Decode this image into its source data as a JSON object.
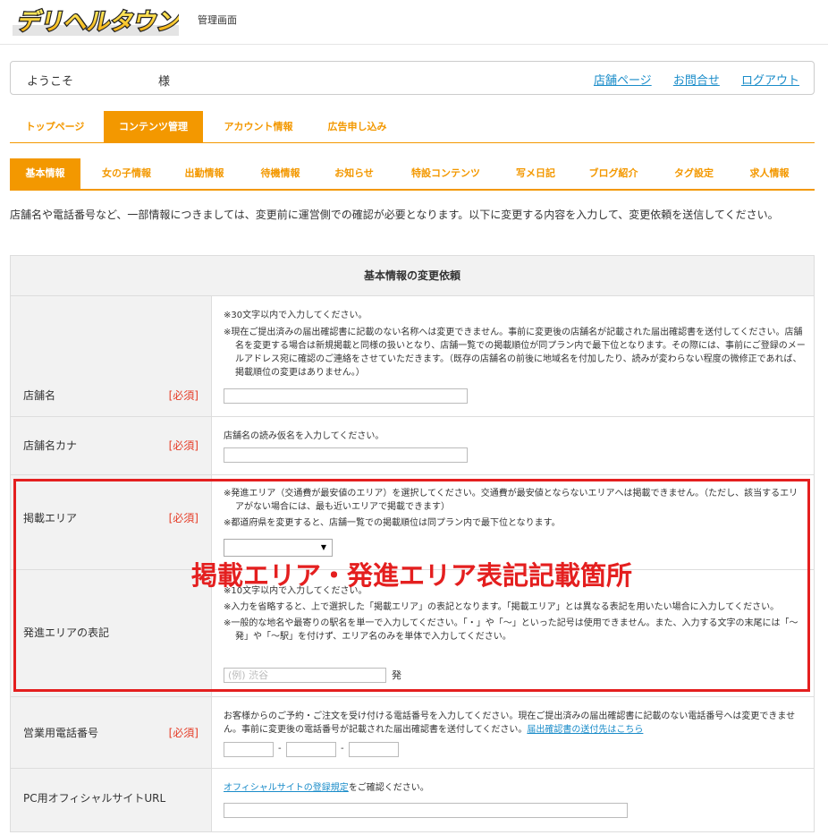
{
  "header": {
    "logo_text": "デリヘルタウン",
    "admin_label": "管理画面"
  },
  "welcome": {
    "greeting": "ようこそ",
    "suffix": "様",
    "links": [
      "店舗ページ",
      "お問合せ",
      "ログアウト"
    ]
  },
  "tabs_main": [
    "トップページ",
    "コンテンツ管理",
    "アカウント情報",
    "広告申し込み"
  ],
  "tabs_main_active": "コンテンツ管理",
  "tabs_sub": [
    "基本情報",
    "女の子情報",
    "出勤情報",
    "待機情報",
    "お知らせ",
    "特設コンテンツ",
    "写メ日記",
    "ブログ紹介",
    "タグ設定",
    "求人情報"
  ],
  "tabs_sub_active": "基本情報",
  "notice": "店舗名や電話番号など、一部情報につきましては、変更前に運営側での確認が必要となります。以下に変更する内容を入力して、変更依頼を送信してください。",
  "form": {
    "title": "基本情報の変更依頼",
    "required_label": "[必須]",
    "store_name": {
      "label": "店舗名",
      "note1": "※30文字以内で入力してください。",
      "note2": "※現在ご提出済みの届出確認書に記載のない名称へは変更できません。事前に変更後の店舗名が記載された届出確認書を送付してください。店舗名を変更する場合は新規掲載と同様の扱いとなり、店舗一覧での掲載順位が同プラン内で最下位となります。その際には、事前にご登録のメールアドレス宛に確認のご連絡をさせていただきます。（既存の店舗名の前後に地域名を付加したり、読みが変わらない程度の微修正であれば、掲載順位の変更はありません。）",
      "value": ""
    },
    "store_kana": {
      "label": "店舗名カナ",
      "note": "店舗名の読み仮名を入力してください。",
      "value": ""
    },
    "area": {
      "label": "掲載エリア",
      "note1": "※発進エリア（交通費が最安値のエリア）を選択してください。交通費が最安値とならないエリアへは掲載できません。（ただし、該当するエリアがない場合には、最も近いエリアで掲載できます）",
      "note2": "※都道府県を変更すると、店舗一覧での掲載順位は同プラン内で最下位となります。",
      "selected": ""
    },
    "departure": {
      "label": "発進エリアの表記",
      "note1": "※10文字以内で入力してください。",
      "note2": "※入力を省略すると、上で選択した「掲載エリア」の表記となります。「掲載エリア」とは異なる表記を用いたい場合に入力してください。",
      "note3": "※一般的な地名や最寄りの駅名を単一で入力してください。「・」や「〜」といった記号は使用できません。また、入力する文字の末尾には「〜発」や「〜駅」を付けず、エリア名のみを単体で入力してください。",
      "placeholder": "(例) 渋谷",
      "suffix": "発"
    },
    "phone": {
      "label": "営業用電話番号",
      "note_text": "お客様からのご予約・ご注文を受け付ける電話番号を入力してください。現在ご提出済みの届出確認書に記載のない電話番号へは変更できません。事前に変更後の電話番号が記載された届出確認書を送付してください。",
      "note_link": "届出確認書の送付先はこちら",
      "sep": "-"
    },
    "pc_url": {
      "label": "PC用オフィシャルサイトURL",
      "note_link": "オフィシャルサイトの登録規定",
      "note_text": "をご確認ください。",
      "value": ""
    }
  },
  "overlay": {
    "text": "掲載エリア・発進エリア表記記載箇所"
  },
  "colors": {
    "accent": "#f39800",
    "link": "#1a8cc9",
    "required": "#e53c27",
    "highlight": "#e41f1f"
  }
}
